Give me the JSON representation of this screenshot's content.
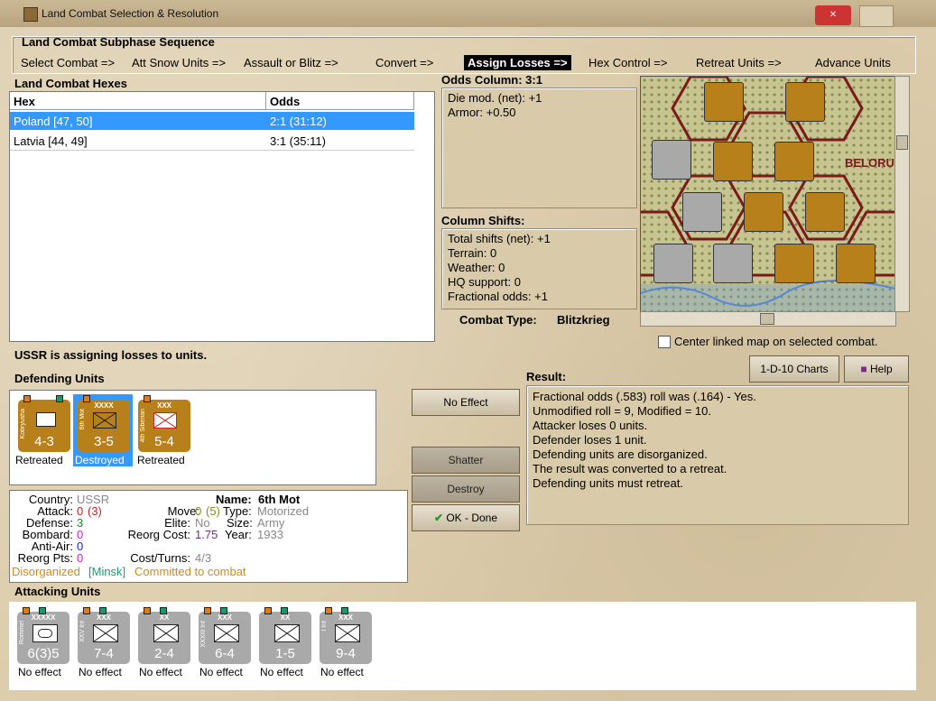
{
  "window": {
    "title": "Land Combat Selection & Resolution"
  },
  "subphase": {
    "heading": "Land Combat Subphase Sequence",
    "steps": [
      {
        "label": "Select Combat =>"
      },
      {
        "label": "Att Snow Units =>"
      },
      {
        "label": "Assault or Blitz =>"
      },
      {
        "label": "Convert =>"
      },
      {
        "label": "Assign Losses =>"
      },
      {
        "label": "Hex Control =>"
      },
      {
        "label": "Retreat Units =>"
      },
      {
        "label": "Advance Units"
      }
    ],
    "active_index": 4
  },
  "hexes": {
    "heading": "Land Combat Hexes",
    "columns": [
      "Hex",
      "Odds"
    ],
    "rows": [
      {
        "hex": "Poland [47, 50]",
        "odds": "2:1 (31:12)",
        "selected": true
      },
      {
        "hex": "Latvia [44, 49]",
        "odds": "3:1 (35:11)",
        "selected": false
      }
    ]
  },
  "odds": {
    "heading": "Odds Column: 3:1",
    "lines": [
      "Die mod. (net): +1",
      "Armor: +0.50"
    ]
  },
  "shifts": {
    "heading": "Column Shifts:",
    "lines": [
      "Total shifts (net): +1",
      "Terrain: 0",
      "Weather: 0",
      "HQ support: 0",
      "Fractional odds: +1"
    ]
  },
  "combat_type": {
    "label": "Combat Type:",
    "value": "Blitzkrieg"
  },
  "status_message": "USSR is assigning losses to units.",
  "map": {
    "center_checkbox_label": "Center linked map on selected combat.",
    "region_label": "BELORU"
  },
  "charts_button": "1-D-10 Charts",
  "help_button": "Help",
  "defending": {
    "heading": "Defending Units",
    "units": [
      {
        "side": "Kobryusha",
        "size": "",
        "value": "4-3",
        "status": "Retreated",
        "selected": false
      },
      {
        "side": "6th Mot",
        "size": "XXXX",
        "value": "3-5",
        "status": "Destroyed",
        "selected": true
      },
      {
        "side": "4th Siberian",
        "size": "XXX",
        "value": "5-4",
        "status": "Retreated",
        "selected": false
      }
    ]
  },
  "buttons": {
    "no_effect": "No Effect",
    "shatter": "Shatter",
    "destroy": "Destroy",
    "ok": "OK - Done"
  },
  "result": {
    "heading": "Result:",
    "lines": [
      "Fractional odds (.583) roll was (.164)  - Yes.",
      "Unmodified roll = 9, Modified = 10.",
      "Attacker loses 0 units.",
      "Defender loses 1 unit.",
      "Defending units are disorganized.",
      "The result was converted to a retreat.",
      "Defending units must retreat."
    ]
  },
  "details": {
    "country_label": "Country:",
    "country": "USSR",
    "attack_label": "Attack:",
    "attack": "0",
    "attack_paren": "(3)",
    "defense_label": "Defense:",
    "defense": "3",
    "bombard_label": "Bombard:",
    "bombard": "0",
    "antiair_label": "Anti-Air:",
    "antiair": "0",
    "reorg_label": "Reorg Pts:",
    "reorg": "0",
    "name_label": "Name:",
    "name": "6th Mot",
    "move_label": "Move:",
    "move": "0",
    "move_paren": "(5)",
    "type_label": "Type:",
    "type": "Motorized",
    "elite_label": "Elite:",
    "elite": "No",
    "size_label": "Size:",
    "size": "Army",
    "reorg_cost_label": "Reorg Cost:",
    "reorg_cost": "1.75",
    "year_label": "Year:",
    "year": "1933",
    "cost_label": "Cost/Turns:",
    "cost": "4/3",
    "flag_disorg": "Disorganized",
    "flag_loc": "[Minsk]",
    "flag_commit": "Committed to combat"
  },
  "attacking": {
    "heading": "Attacking Units",
    "units": [
      {
        "side": "Rommel",
        "size": "XXXXX",
        "value": "6(3)5",
        "status": "No effect"
      },
      {
        "side": "XXV Inf",
        "size": "XXX",
        "value": "7-4",
        "status": "No effect"
      },
      {
        "side": "",
        "size": "XX",
        "value": "2-4",
        "status": "No effect"
      },
      {
        "side": "XXXIII Inf",
        "size": "XXX",
        "value": "6-4",
        "status": "No effect"
      },
      {
        "side": "",
        "size": "XX",
        "value": "1-5",
        "status": "No effect"
      },
      {
        "side": "I Inf",
        "size": "XXX",
        "value": "9-4",
        "status": "No effect"
      }
    ]
  },
  "colors": {
    "german_grey": "#a9a9a9",
    "soviet_brown": "#b8801a",
    "selection": "#3399ff"
  }
}
